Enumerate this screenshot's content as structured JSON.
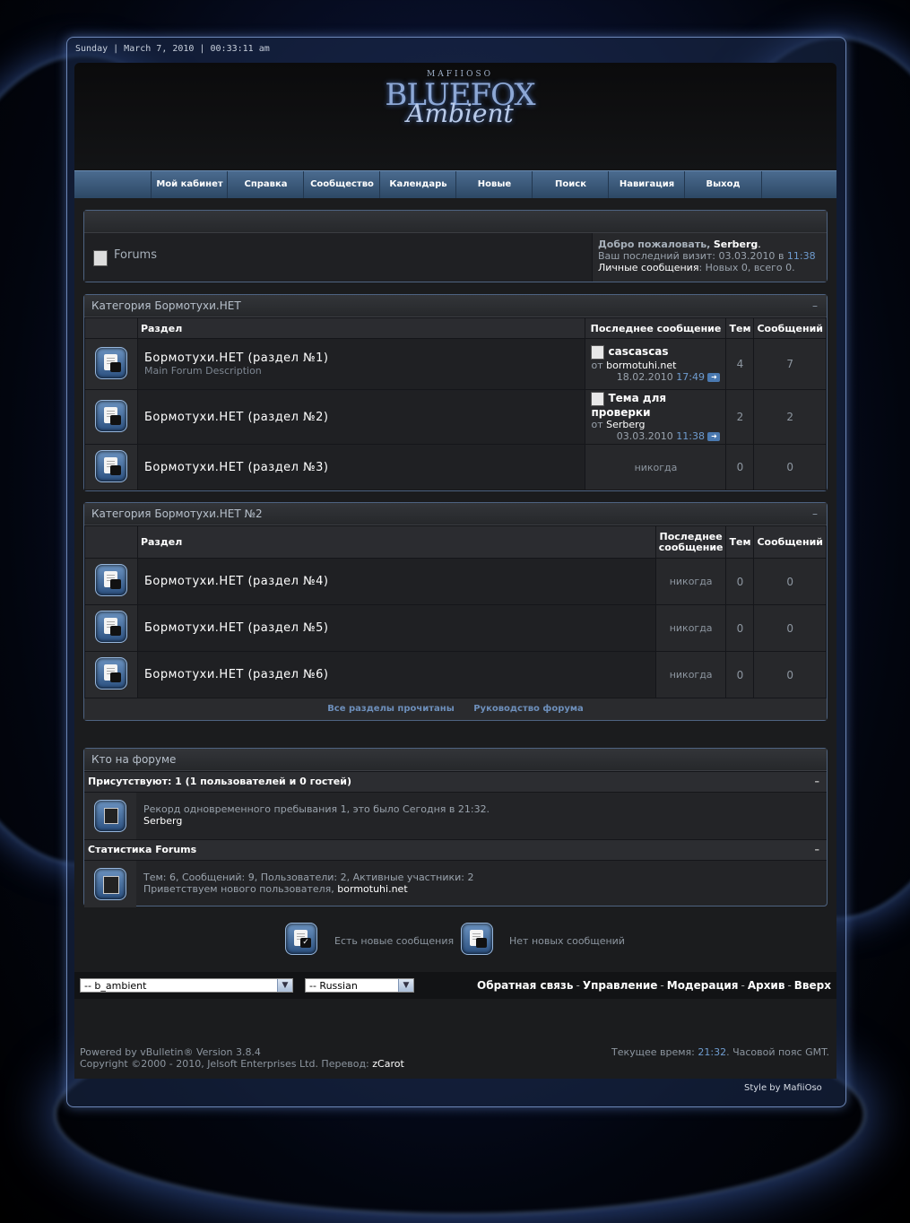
{
  "datebar": "Sunday | March 7, 2010 | 00:33:11 am",
  "logo": {
    "small": "MAFIIOSO",
    "big": "BLUEFOX",
    "script": "Ambient"
  },
  "nav": [
    "Мой кабинет",
    "Справка",
    "Сообщество",
    "Календарь",
    "Новые",
    "Поиск",
    "Навигация",
    "Выход"
  ],
  "welcome": {
    "forums_label": "Forums",
    "greeting": "Добро пожаловать,",
    "user": "Serberg",
    "last_visit_label": "Ваш последний визит:",
    "last_visit_date": "03.03.2010",
    "last_visit_in": "в",
    "last_visit_time": "11:38",
    "pm_label": "Личные сообщения",
    "pm_value": ": Новых 0, всего 0."
  },
  "cat1": {
    "title": "Категория Бормотухи.НЕТ",
    "collapse": "–",
    "headers": {
      "forum": "Раздел",
      "last": "Последнее сообщение",
      "threads": "Тем",
      "posts": "Сообщений"
    },
    "rows": [
      {
        "title": "Бормотухи.НЕТ (раздел №1)",
        "desc": "Main Forum Description",
        "last_title": "cascascas",
        "by": "от",
        "last_user": "bormotuhi.net",
        "last_date": "18.02.2010",
        "last_time": "17:49",
        "threads": "4",
        "posts": "7"
      },
      {
        "title": "Бормотухи.НЕТ (раздел №2)",
        "desc": "",
        "last_title": "Тема для проверки",
        "by": "от",
        "last_user": "Serberg",
        "last_date": "03.03.2010",
        "last_time": "11:38",
        "threads": "2",
        "posts": "2"
      },
      {
        "title": "Бормотухи.НЕТ (раздел №3)",
        "desc": "",
        "never": "никогда",
        "threads": "0",
        "posts": "0"
      }
    ]
  },
  "cat2": {
    "title": "Категория Бормотухи.НЕТ №2",
    "collapse": "–",
    "headers": {
      "forum": "Раздел",
      "last": "Последнее сообщение",
      "threads": "Тем",
      "posts": "Сообщений"
    },
    "rows": [
      {
        "title": "Бормотухи.НЕТ (раздел №4)",
        "never": "никогда",
        "threads": "0",
        "posts": "0"
      },
      {
        "title": "Бормотухи.НЕТ (раздел №5)",
        "never": "никогда",
        "threads": "0",
        "posts": "0"
      },
      {
        "title": "Бормотухи.НЕТ (раздел №6)",
        "never": "никогда",
        "threads": "0",
        "posts": "0"
      }
    ],
    "links": [
      "Все разделы прочитаны",
      "Руководство форума"
    ]
  },
  "who": {
    "title": "Кто на форуме",
    "online_header": "Присутствуют: 1 (1 пользователей и 0 гостей)",
    "record": "Рекорд одновременного пребывания 1, это было Сегодня в 21:32.",
    "online_user": "Serberg",
    "stats_header": "Статистика Forums",
    "stats": "Тем: 6, Сообщений: 9, Пользователи: 2, Активные участники: 2",
    "welcome_new": "Приветствуем нового пользователя,",
    "new_user": "bormotuhi.net",
    "collapse": "–"
  },
  "legend": {
    "new": "Есть новые сообщения",
    "nonew": "Нет новых сообщений"
  },
  "footer": {
    "style_select": "-- b_ambient",
    "lang_select": "-- Russian",
    "links": [
      "Обратная связь",
      "Управление",
      "Модерация",
      "Архив",
      "Вверх"
    ],
    "sep": "-",
    "powered": "Powered by vBulletin® Version 3.8.4",
    "copyright": "Copyright ©2000 - 2010, Jelsoft Enterprises Ltd. Перевод:",
    "translator": "zCarot",
    "time_label": "Текущее время:",
    "time_value": "21:32",
    "tz": ". Часовой пояс GMT.",
    "styleby": "Style by MafiiOso"
  }
}
